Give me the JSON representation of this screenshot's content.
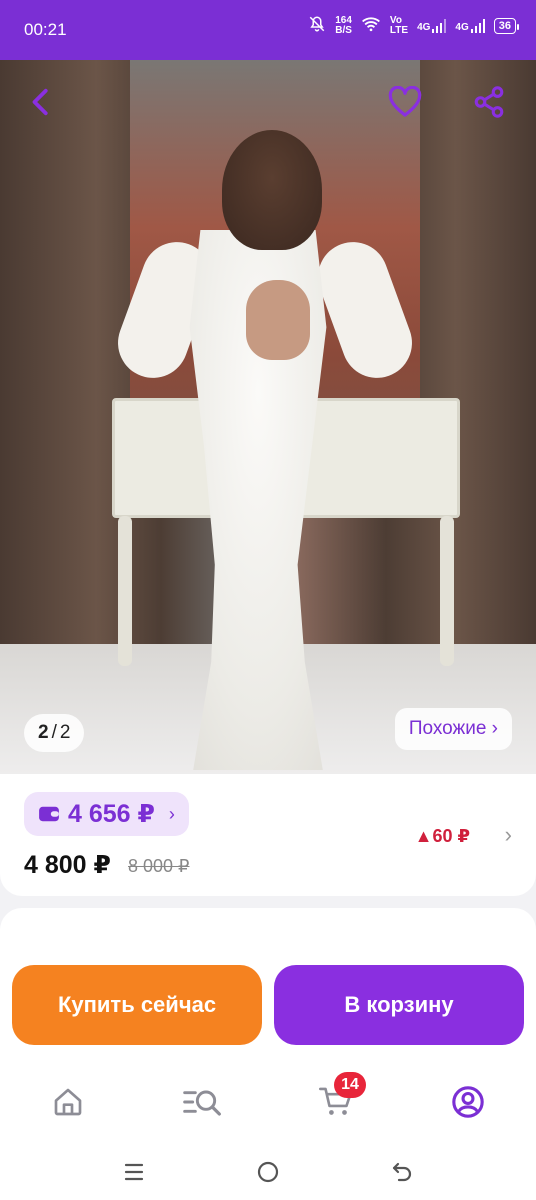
{
  "status_bar": {
    "time": "00:21",
    "net_speed_top": "164",
    "net_speed_unit": "B/S",
    "volte_top": "Vo",
    "volte_bottom": "LTE",
    "sig1": "4G",
    "sig2": "4G",
    "battery": "36"
  },
  "gallery": {
    "counter_current": "2",
    "counter_total": "2",
    "similar_label": "Похожие ›"
  },
  "price": {
    "wallet_price": "4 656 ₽",
    "wallet_chevron": "›",
    "current_price": "4 800 ₽",
    "old_price": "8 000 ₽",
    "price_drop": "▲60 ₽",
    "price_drop_chevron": "›"
  },
  "actions": {
    "buy_now": "Купить сейчас",
    "add_to_cart": "В корзину"
  },
  "bottom_nav": {
    "cart_badge": "14"
  },
  "colors": {
    "brand_purple": "#7b2fd4",
    "buy_orange": "#f58220",
    "cart_purple": "#8a2fe0",
    "badge_red": "#e8253a",
    "drop_red": "#d0203c"
  },
  "icons": [
    "back-arrow-icon",
    "heart-icon",
    "share-icon",
    "wallet-icon",
    "home-icon",
    "catalog-search-icon",
    "cart-icon",
    "profile-icon"
  ]
}
